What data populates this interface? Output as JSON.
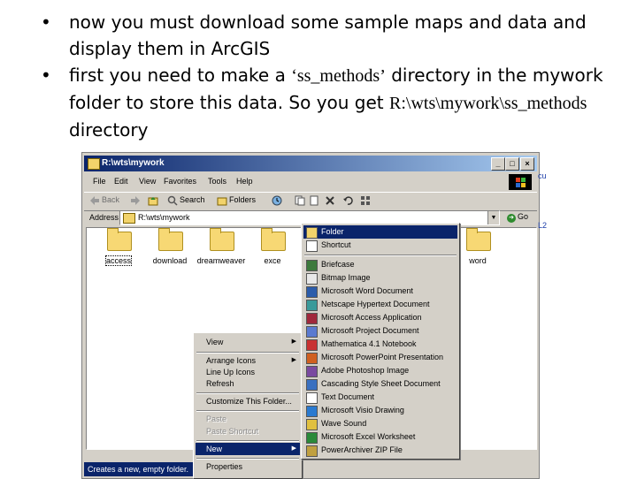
{
  "slide": {
    "bullet_symbol": "•",
    "bullet1": "now you must download some sample maps and data and display them in ArcGIS",
    "bullet2_part1": "first you need to make a ",
    "bullet2_quote": "‘ss_methods’",
    "bullet2_part2": " directory in the mywork folder to store this data. So you get ",
    "bullet2_path": "R:\\wts\\mywork\\ss_methods",
    "bullet2_part3": " directory"
  },
  "window": {
    "title": "R:\\wts\\mywork",
    "buttons": {
      "minimize": "_",
      "maximize": "□",
      "close": "×"
    },
    "menu": [
      "File",
      "Edit",
      "View",
      "Favorites",
      "Tools",
      "Help"
    ],
    "toolbar": {
      "back": "Back",
      "search": "Search",
      "folders": "Folders"
    },
    "address_label": "Address",
    "address_value": "R:\\wts\\mywork",
    "go_label": "Go",
    "folders": [
      "access",
      "download",
      "dreamweaver",
      "exce",
      "word"
    ],
    "status_text": "Creates a new, empty folder."
  },
  "context_menu": {
    "items": [
      {
        "label": "View",
        "submenu": true,
        "disabled": false
      },
      {
        "label": "Arrange Icons",
        "submenu": true,
        "disabled": false
      },
      {
        "label": "Line Up Icons",
        "submenu": false,
        "disabled": false
      },
      {
        "label": "Refresh",
        "submenu": false,
        "disabled": false
      },
      {
        "label": "Customize This Folder...",
        "submenu": false,
        "disabled": false
      },
      {
        "label": "Paste",
        "submenu": false,
        "disabled": true
      },
      {
        "label": "Paste Shortcut",
        "submenu": false,
        "disabled": true
      },
      {
        "label": "New",
        "submenu": true,
        "disabled": false,
        "highlighted": true
      },
      {
        "label": "Properties",
        "submenu": false,
        "disabled": false
      }
    ],
    "submenu_arrow": "▶"
  },
  "new_submenu": {
    "items": [
      {
        "label": "Folder",
        "icon": "folder-icon",
        "color": "#f2d36b"
      },
      {
        "label": "Shortcut",
        "icon": "shortcut-icon",
        "color": "#ffffff"
      },
      {
        "label": "Briefcase",
        "icon": "briefcase-icon",
        "color": "#3d7a3d"
      },
      {
        "label": "Bitmap Image",
        "icon": "bitmap-icon",
        "color": "#e8e8e8"
      },
      {
        "label": "Microsoft Word Document",
        "icon": "word-icon",
        "color": "#2b5caa"
      },
      {
        "label": "Netscape Hypertext Document",
        "icon": "netscape-icon",
        "color": "#3a9a9a"
      },
      {
        "label": "Microsoft Access Application",
        "icon": "access-icon",
        "color": "#a0283c"
      },
      {
        "label": "Microsoft Project Document",
        "icon": "project-icon",
        "color": "#5a7ad0"
      },
      {
        "label": "Mathematica 4.1 Notebook",
        "icon": "mathematica-icon",
        "color": "#c83232"
      },
      {
        "label": "Microsoft PowerPoint Presentation",
        "icon": "powerpoint-icon",
        "color": "#d06020"
      },
      {
        "label": "Adobe Photoshop Image",
        "icon": "photoshop-icon",
        "color": "#7a4aa0"
      },
      {
        "label": "Cascading Style Sheet Document",
        "icon": "css-icon",
        "color": "#3a70c0"
      },
      {
        "label": "Text Document",
        "icon": "text-icon",
        "color": "#ffffff"
      },
      {
        "label": "Microsoft Visio Drawing",
        "icon": "visio-icon",
        "color": "#2a7ad0"
      },
      {
        "label": "Wave Sound",
        "icon": "sound-icon",
        "color": "#e0c040"
      },
      {
        "label": "Microsoft Excel Worksheet",
        "icon": "excel-icon",
        "color": "#2a8a3a"
      },
      {
        "label": "PowerArchiver ZIP File",
        "icon": "zip-icon",
        "color": "#c0a040"
      }
    ]
  },
  "edge_fragments": {
    "right_top": "cu",
    "right_mid": "L2"
  }
}
